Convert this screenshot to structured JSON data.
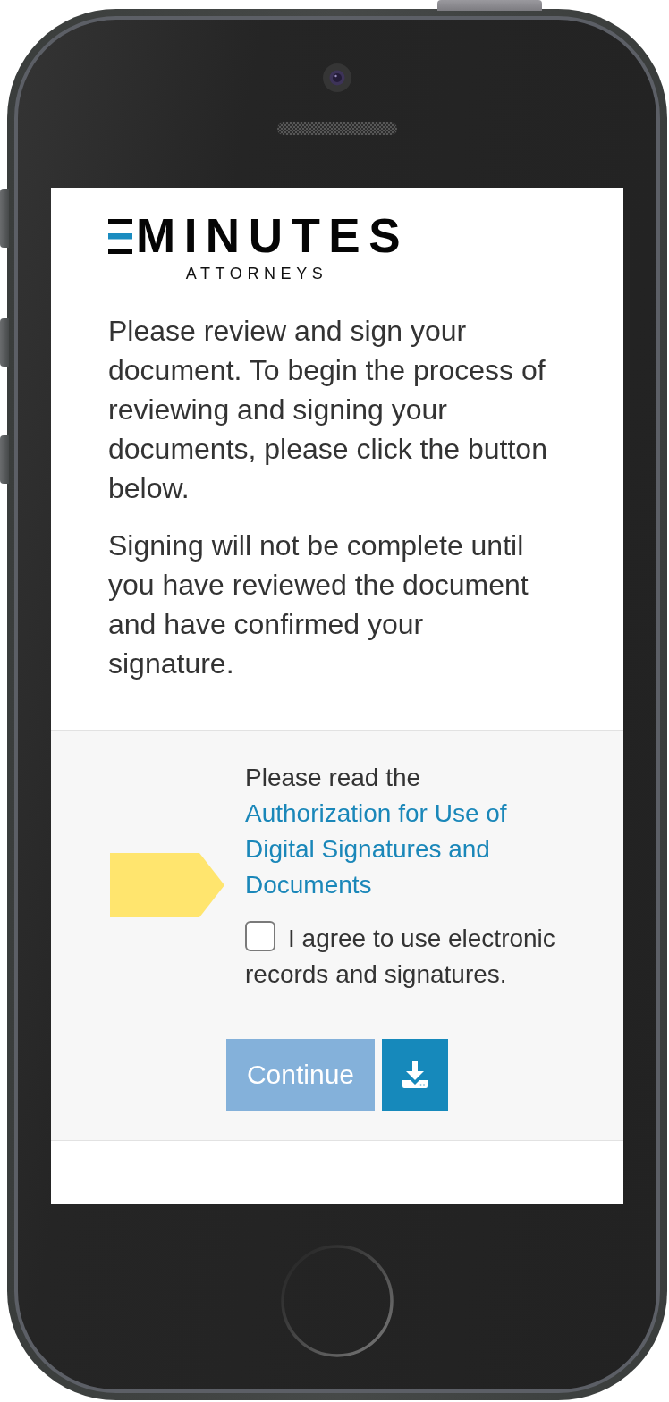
{
  "logo": {
    "wordmark": "MINUTES",
    "tagline": "ATTORNEYS"
  },
  "intro": [
    "Please review and sign your document. To begin the process of reviewing and signing your documents, please click the button below.",
    "Signing will not be complete until you have reviewed the document and have confirmed your signature."
  ],
  "consent": {
    "prompt": "Please read the",
    "link": "Authorization for Use of Digital Signatures and Documents",
    "checkbox": {
      "label": "I agree to use electronic records and signatures.",
      "checked": false
    }
  },
  "actions": {
    "continue": {
      "label": "Continue",
      "disabled": true
    }
  }
}
